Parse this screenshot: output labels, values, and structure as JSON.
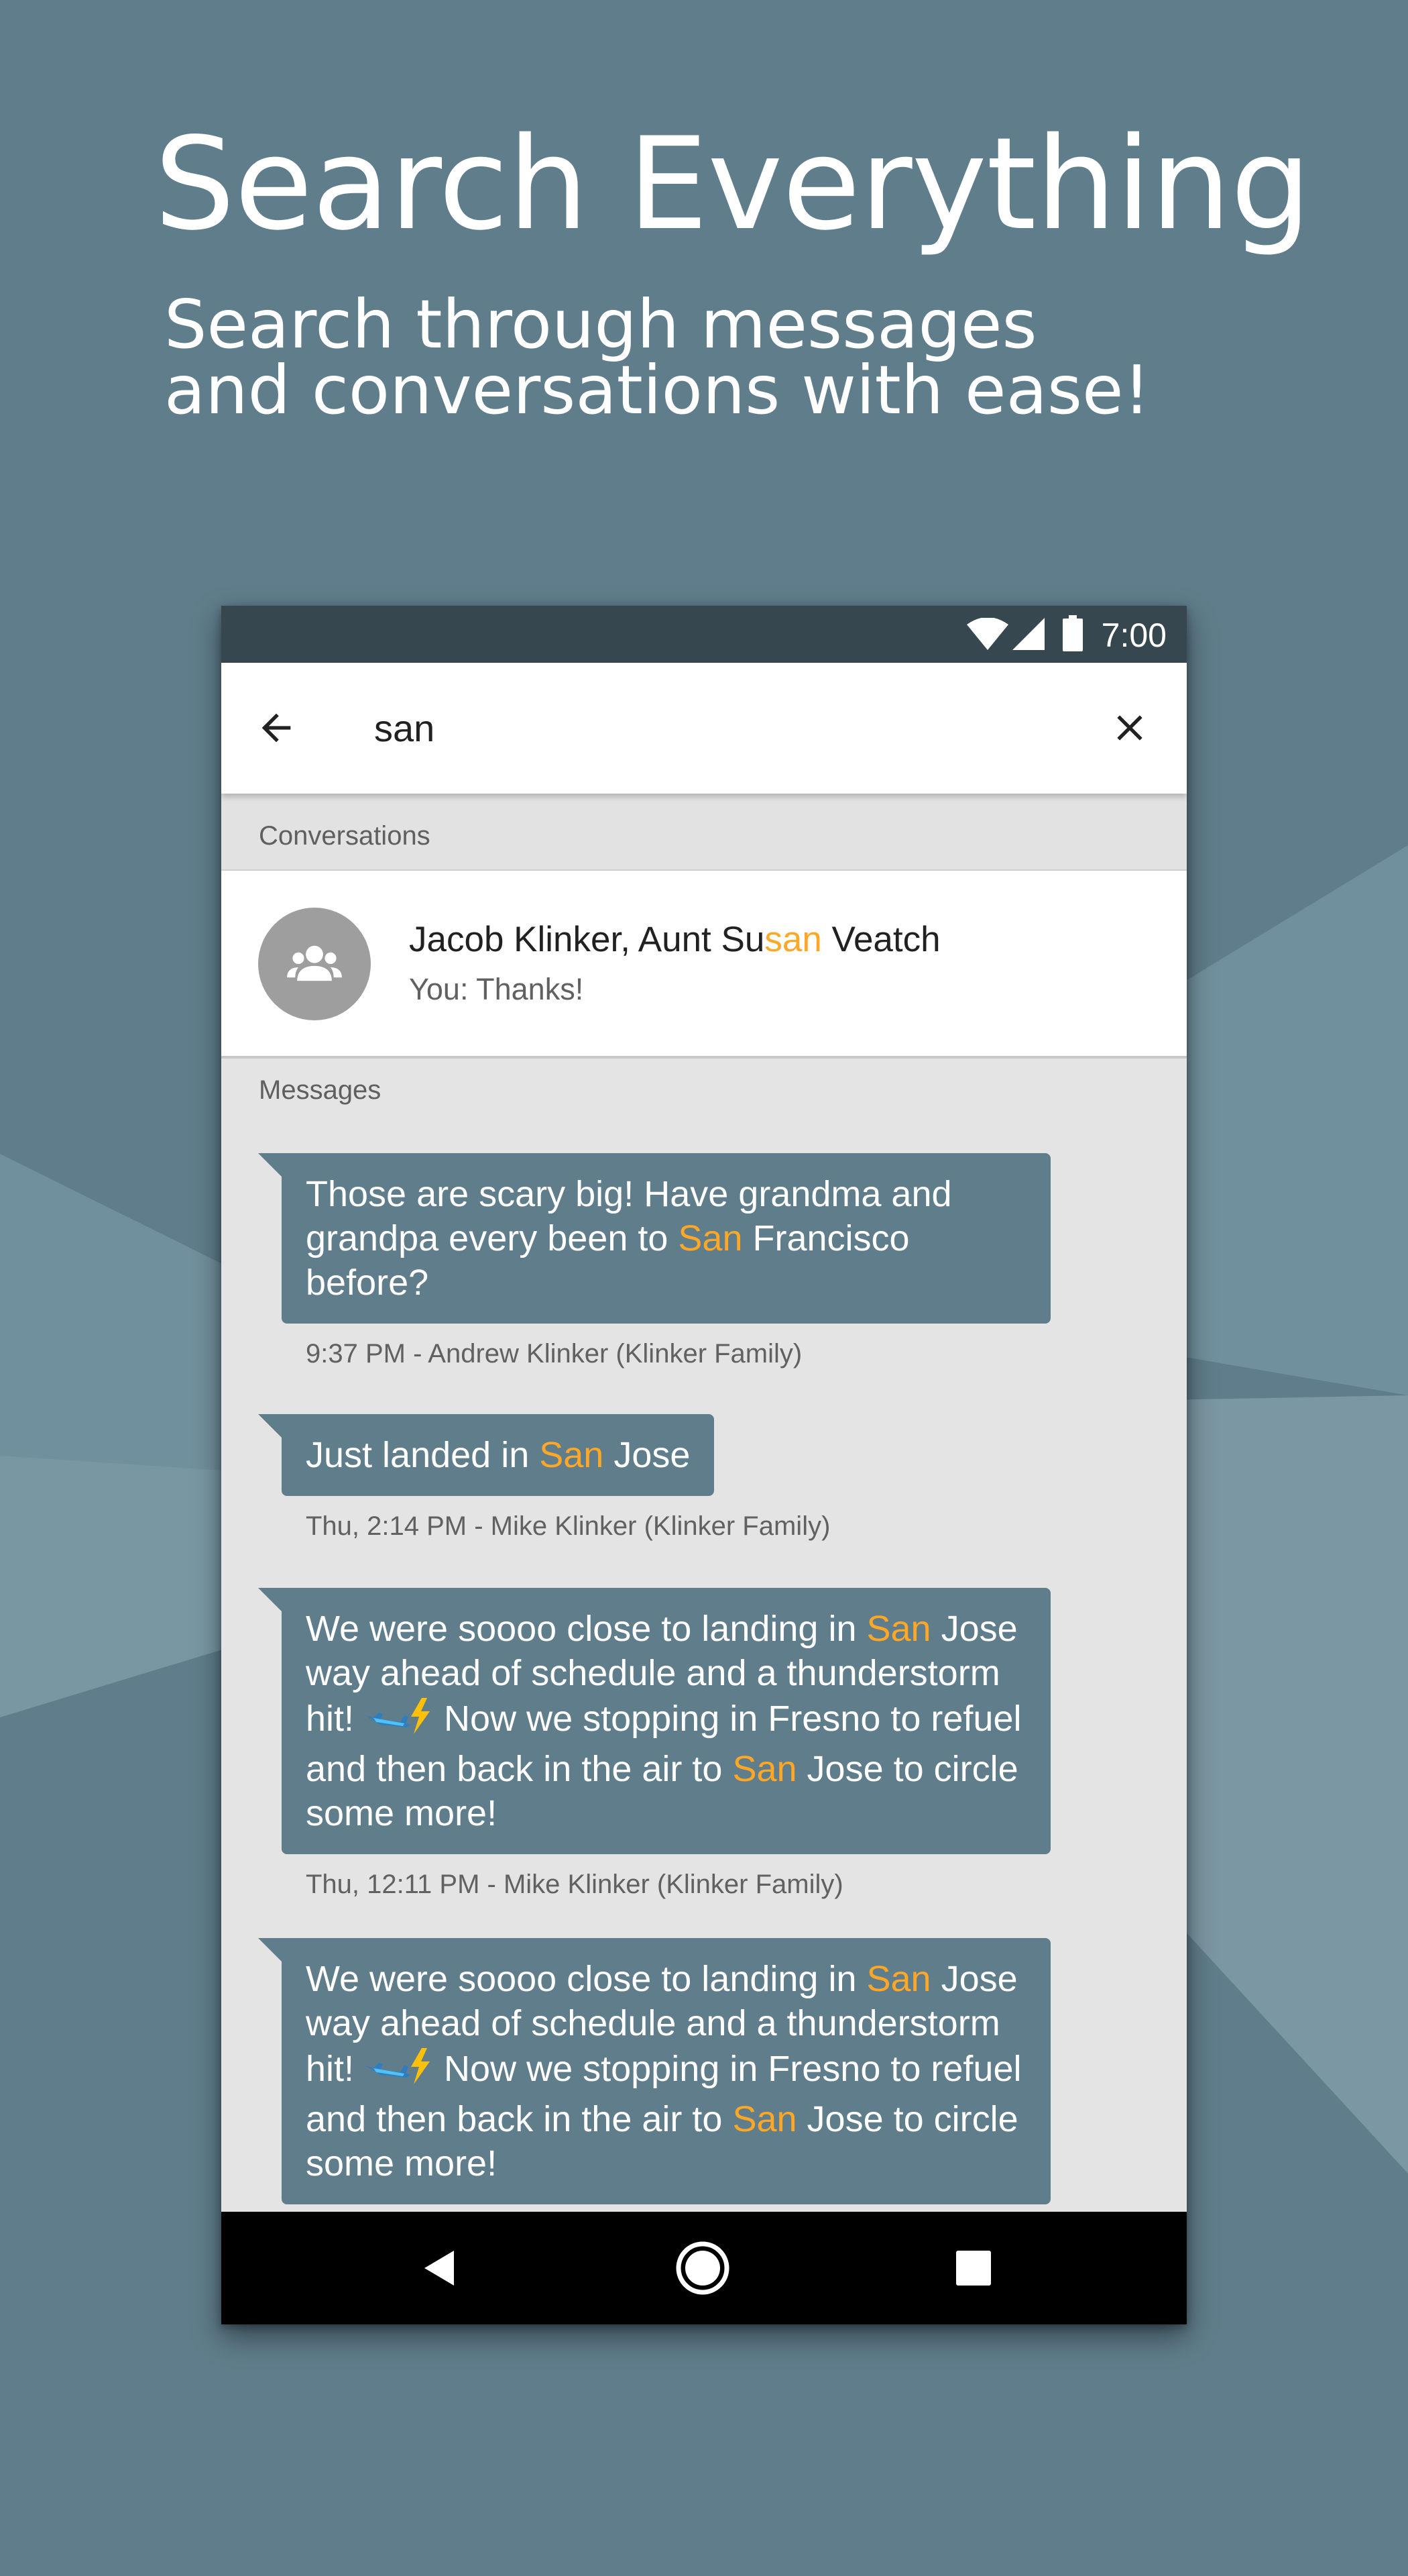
{
  "headline": "Search Everything",
  "subline": {
    "line1": "Search through messages",
    "line2": "and conversations with ease!"
  },
  "colors": {
    "background": "#607D8B",
    "status_bar": "#37474F",
    "bubble": "#607D8B",
    "highlight": "#FFA726",
    "avatar": "#9E9E9E"
  },
  "status_bar": {
    "time": "7:00",
    "icons": [
      "wifi-icon",
      "cell-signal-icon",
      "battery-icon"
    ]
  },
  "search": {
    "back_icon": "arrow-back-icon",
    "query": "san",
    "clear_icon": "close-icon"
  },
  "sections": {
    "conversations": "Conversations",
    "messages": "Messages"
  },
  "conversation": {
    "avatar_icon": "group-icon",
    "title_before": "Jacob Klinker, Aunt Su",
    "title_match": "san",
    "title_after": " Veatch",
    "snippet": "You: Thanks!"
  },
  "messages": [
    {
      "before": "Those are scary big! Have grandma and grandpa every been to ",
      "match": "San",
      "after": " Francisco before?",
      "meta": "9:37 PM - Andrew Klinker (Klinker Family)"
    },
    {
      "before": "Just landed in ",
      "match": "San",
      "after": " Jose",
      "meta": "Thu, 2:14 PM - Mike Klinker (Klinker Family)"
    },
    {
      "p1": "We were soooo close to landing in ",
      "m1": "San",
      "p2": " Jose way ahead of schedule and a thunderstorm hit! ",
      "emoji": "airplane-lightning-emoji",
      "p3": " Now we stopping in Fresno to refuel and then back in the air to ",
      "m2": "San",
      "p4": " Jose to circle some more!",
      "meta": "Thu, 12:11 PM - Mike Klinker (Klinker Family)"
    },
    {
      "p1": "We were soooo close to landing in ",
      "m1": "San",
      "p2": " Jose way ahead of schedule and a thunderstorm hit! ",
      "emoji": "airplane-lightning-emoji",
      "p3": " Now we stopping in Fresno to refuel and then back in the air to ",
      "m2": "San",
      "p4": " Jose to circle some more!"
    }
  ],
  "nav_bar": {
    "icons": [
      "nav-back-icon",
      "nav-home-icon",
      "nav-recents-icon"
    ]
  }
}
